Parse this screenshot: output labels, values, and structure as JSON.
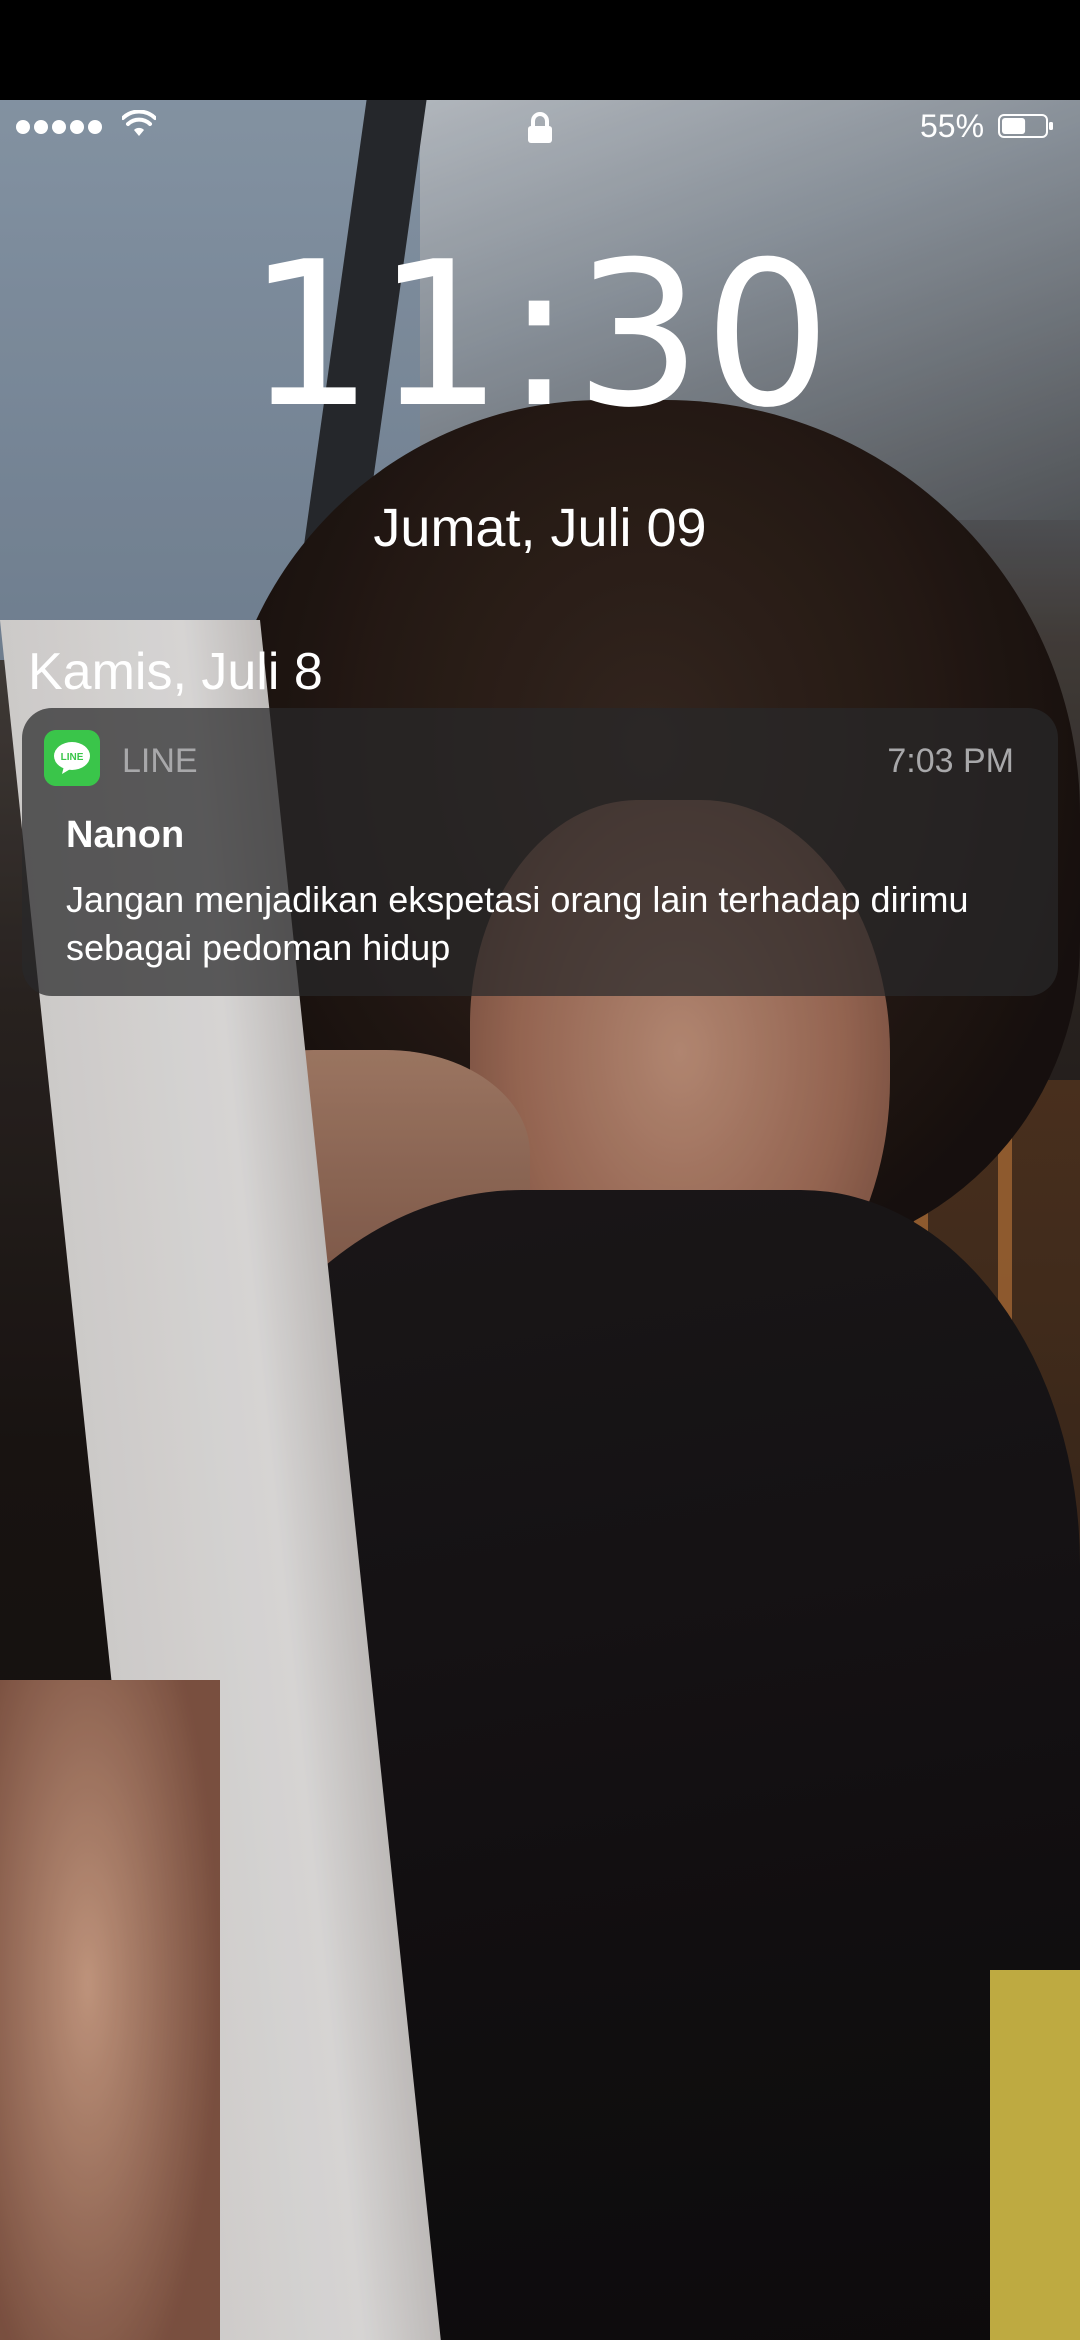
{
  "status_bar": {
    "signal_bars": 5,
    "wifi_icon": "wifi-icon",
    "lock_icon": "lock-icon",
    "battery_percent": "55%",
    "battery_level": 0.55
  },
  "lock_screen": {
    "time": "11:30",
    "date": "Jumat, Juli 09",
    "section_date": "Kamis, Juli 8"
  },
  "notification": {
    "app_icon": "line-app-icon",
    "app_icon_text": "LINE",
    "app_icon_color": "#3ac54a",
    "app_name": "LINE",
    "time": "7:03 PM",
    "sender": "Nanon",
    "message": "Jangan menjadikan ekspetasi orang lain terhadap dirimu sebagai pedoman hidup"
  }
}
